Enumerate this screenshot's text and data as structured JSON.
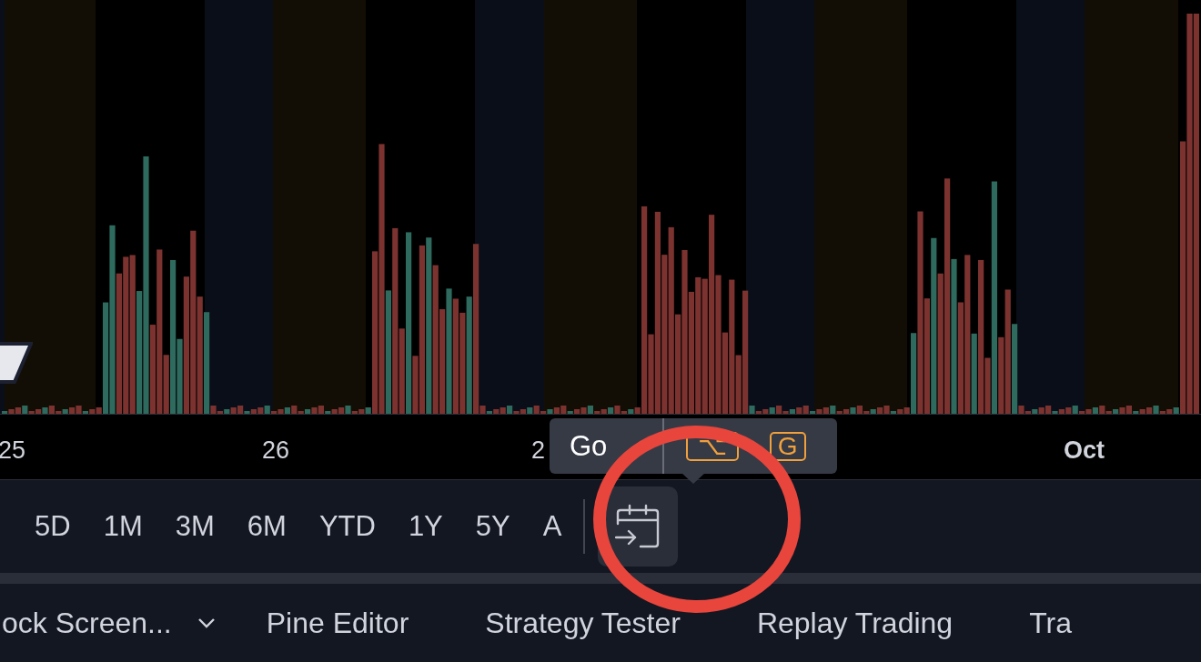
{
  "x_axis": {
    "labels": [
      {
        "text": "25",
        "bold": false
      },
      {
        "text": "26",
        "bold": false
      },
      {
        "text": "2",
        "bold": false
      },
      {
        "text": "Oct",
        "bold": true
      }
    ]
  },
  "tooltip": {
    "text": "Go",
    "keys": [
      "⌥",
      "G"
    ]
  },
  "range_bar": {
    "ranges": [
      {
        "label": "5D",
        "selected": false
      },
      {
        "label": "1M",
        "selected": false
      },
      {
        "label": "3M",
        "selected": false
      },
      {
        "label": "6M",
        "selected": false
      },
      {
        "label": "YTD",
        "selected": false
      },
      {
        "label": "1Y",
        "selected": false
      },
      {
        "label": "5Y",
        "selected": false
      },
      {
        "label": "A",
        "selected": false
      }
    ],
    "goto_button": {
      "hovered": true
    }
  },
  "bottom_tabs": [
    {
      "label": "ock Screen...",
      "dropdown": true
    },
    {
      "label": "Pine Editor",
      "dropdown": false
    },
    {
      "label": "Strategy Tester",
      "dropdown": false
    },
    {
      "label": "Replay Trading",
      "dropdown": false
    },
    {
      "label": "Tra",
      "dropdown": false
    }
  ]
}
